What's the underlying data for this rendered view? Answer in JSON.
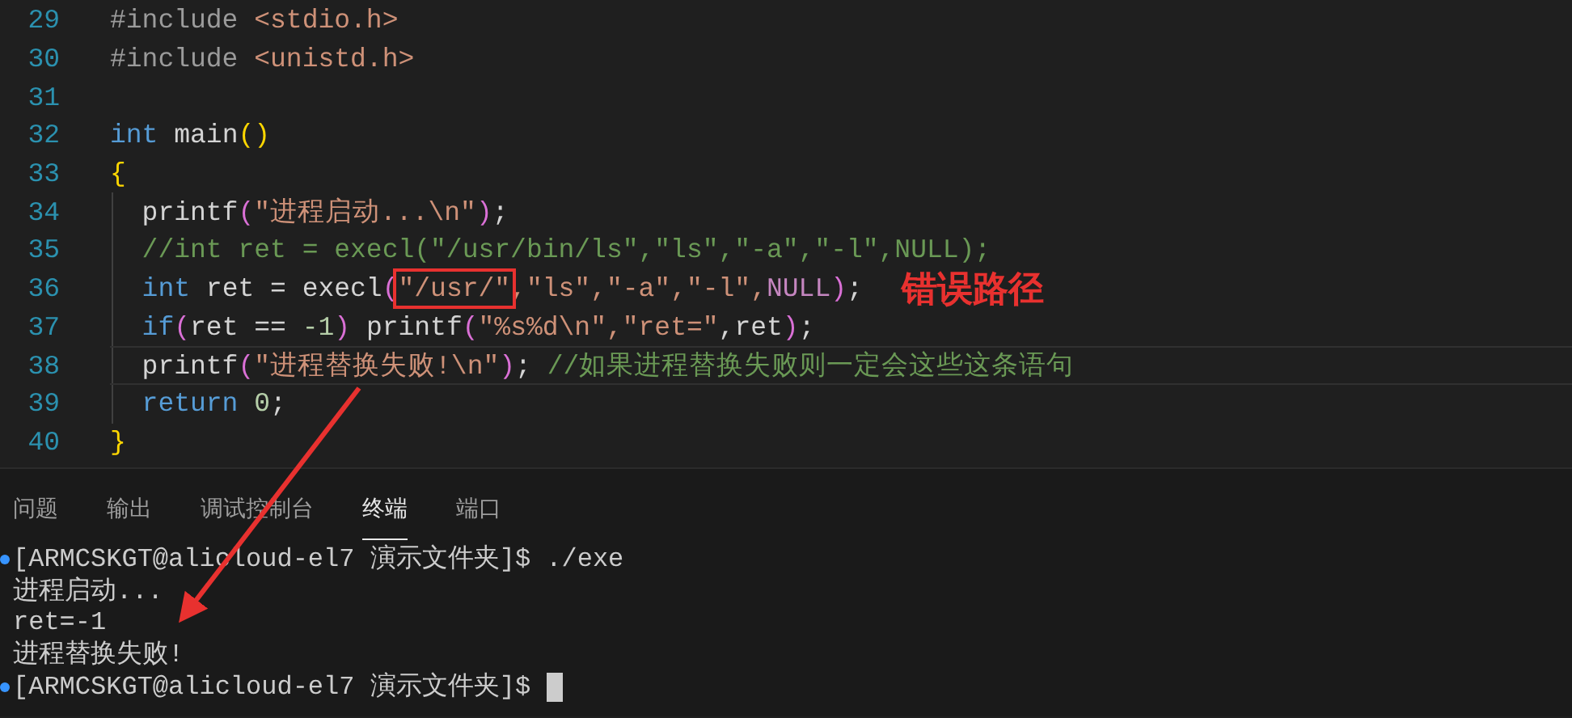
{
  "editor": {
    "lines": [
      {
        "number": "29",
        "current": false,
        "tokens": [
          {
            "kind": "pp",
            "text": "#include "
          },
          {
            "kind": "header",
            "text": "<stdio.h>"
          }
        ]
      },
      {
        "number": "30",
        "current": false,
        "tokens": [
          {
            "kind": "pp",
            "text": "#include "
          },
          {
            "kind": "header",
            "text": "<unistd.h>"
          }
        ]
      },
      {
        "number": "31",
        "current": false
      },
      {
        "number": "32",
        "current": false,
        "tokens": [
          {
            "kind": "keyword",
            "text": "int"
          },
          {
            "kind": "plain",
            "text": " main"
          },
          {
            "kind": "bracket1",
            "text": "()"
          }
        ]
      },
      {
        "number": "33",
        "current": false,
        "tokens": [
          {
            "kind": "bracket1",
            "text": "{"
          }
        ]
      },
      {
        "number": "34",
        "current": false,
        "tokens": [
          {
            "kind": "plain",
            "text": "  printf"
          },
          {
            "kind": "bracket2",
            "text": "("
          },
          {
            "kind": "string",
            "text": "\"进程启动...\\n\""
          },
          {
            "kind": "bracket2",
            "text": ")"
          },
          {
            "kind": "plain",
            "text": ";"
          }
        ]
      },
      {
        "number": "35",
        "current": false,
        "tokens": [
          {
            "kind": "comment",
            "text": "  //int ret = execl(\"/usr/bin/ls\",\"ls\",\"-a\",\"-l\",NULL);"
          }
        ]
      },
      {
        "number": "36",
        "current": false,
        "note": "错误路径",
        "tokens": [
          {
            "kind": "keyword",
            "text": "  int"
          },
          {
            "kind": "plain",
            "text": " ret = execl"
          },
          {
            "kind": "bracket2",
            "text": "("
          },
          {
            "kind": "boxed-string",
            "text": "\"/usr/\""
          },
          {
            "kind": "string",
            "text": ",\"ls\",\"-a\",\"-l\","
          },
          {
            "kind": "macro",
            "text": "NULL"
          },
          {
            "kind": "bracket2",
            "text": ")"
          },
          {
            "kind": "plain",
            "text": ";"
          }
        ]
      },
      {
        "number": "37",
        "current": false,
        "tokens": [
          {
            "kind": "keyword",
            "text": "  if"
          },
          {
            "kind": "bracket2",
            "text": "("
          },
          {
            "kind": "plain",
            "text": "ret == "
          },
          {
            "kind": "number",
            "text": "-1"
          },
          {
            "kind": "bracket2",
            "text": ")"
          },
          {
            "kind": "plain",
            "text": " printf"
          },
          {
            "kind": "bracket2",
            "text": "("
          },
          {
            "kind": "string",
            "text": "\"%s%d\\n\",\"ret=\""
          },
          {
            "kind": "plain",
            "text": ",ret"
          },
          {
            "kind": "bracket2",
            "text": ")"
          },
          {
            "kind": "plain",
            "text": ";"
          }
        ]
      },
      {
        "number": "38",
        "current": true,
        "tokens": [
          {
            "kind": "plain",
            "text": "  printf"
          },
          {
            "kind": "bracket2",
            "text": "("
          },
          {
            "kind": "string",
            "text": "\"进程替换失败!\\n\""
          },
          {
            "kind": "bracket2",
            "text": ")"
          },
          {
            "kind": "plain",
            "text": "; "
          },
          {
            "kind": "comment",
            "text": "//如果进程替换失败则一定会这些这条语句"
          }
        ]
      },
      {
        "number": "39",
        "current": false,
        "tokens": [
          {
            "kind": "keyword",
            "text": "  return"
          },
          {
            "kind": "number",
            "text": " 0"
          },
          {
            "kind": "plain",
            "text": ";"
          }
        ]
      },
      {
        "number": "40",
        "current": false,
        "tokens": [
          {
            "kind": "bracket1",
            "text": "}"
          }
        ]
      }
    ]
  },
  "panel": {
    "tabs": [
      {
        "label": "问题",
        "selected": false
      },
      {
        "label": "输出",
        "selected": false
      },
      {
        "label": "调试控制台",
        "selected": false
      },
      {
        "label": "终端",
        "selected": true
      },
      {
        "label": "端口",
        "selected": false
      }
    ],
    "terminal": [
      {
        "kind": "command",
        "text": "[ARMCSKGT@alicloud-el7 演示文件夹]$ ./exe"
      },
      {
        "kind": "output",
        "text": "进程启动..."
      },
      {
        "kind": "output",
        "text": "ret=-1"
      },
      {
        "kind": "output",
        "text": "进程替换失败!"
      },
      {
        "kind": "prompt",
        "text": "[ARMCSKGT@alicloud-el7 演示文件夹]$ "
      }
    ]
  }
}
